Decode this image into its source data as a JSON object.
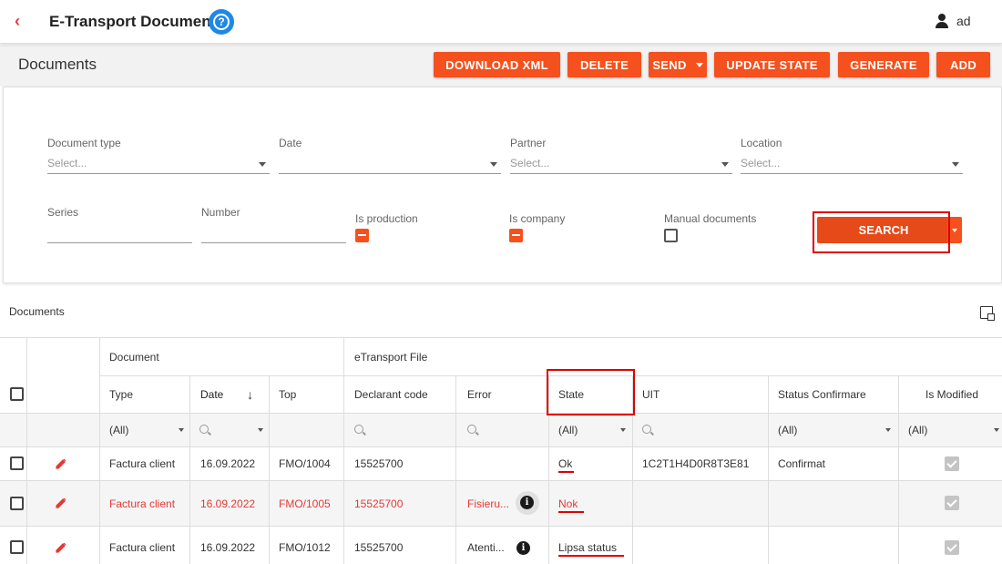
{
  "header": {
    "back_icon": "chevron-left-icon",
    "title": "E-Transport Documents",
    "help_icon": "?",
    "user": "ad"
  },
  "toolbar": {
    "title": "Documents",
    "buttons": {
      "download_xml": "DOWNLOAD XML",
      "delete": "DELETE",
      "send": "SEND",
      "update_state": "UPDATE STATE",
      "generate": "GENERATE",
      "add": "ADD"
    }
  },
  "filters": {
    "document_type": {
      "label": "Document type",
      "placeholder": "Select..."
    },
    "date": {
      "label": "Date",
      "placeholder": ""
    },
    "partner": {
      "label": "Partner",
      "placeholder": "Select..."
    },
    "location": {
      "label": "Location",
      "placeholder": "Select..."
    },
    "series": {
      "label": "Series",
      "value": ""
    },
    "number": {
      "label": "Number",
      "value": ""
    },
    "is_production": {
      "label": "Is production",
      "state": "indeterminate"
    },
    "is_company": {
      "label": "Is company",
      "state": "indeterminate"
    },
    "manual_documents": {
      "label": "Manual documents",
      "state": "unchecked"
    },
    "search_button": "SEARCH"
  },
  "grid": {
    "title": "Documents",
    "bands": {
      "document": "Document",
      "etransport": "eTransport File"
    },
    "columns": {
      "type": "Type",
      "date": "Date",
      "top": "Top",
      "declarant_code": "Declarant code",
      "error": "Error",
      "state": "State",
      "uit": "UIT",
      "status_confirmare": "Status Confirmare",
      "is_modified": "Is Modified"
    },
    "filter_row": {
      "type": "(All)",
      "state": "(All)",
      "status_confirmare": "(All)",
      "is_modified": "(All)"
    },
    "rows": [
      {
        "type": "Factura client",
        "date": "16.09.2022",
        "top": "FMO/1004",
        "declarant_code": "15525700",
        "error": "",
        "state": "Ok",
        "uit": "1C2T1H4D0R8T3E81",
        "status_confirmare": "Confirmat",
        "is_modified": true
      },
      {
        "type": "Factura client",
        "date": "16.09.2022",
        "top": "FMO/1005",
        "declarant_code": "15525700",
        "error": "Fisieru...",
        "state": "Nok",
        "uit": "",
        "status_confirmare": "",
        "is_modified": true
      },
      {
        "type": "Factura client",
        "date": "16.09.2022",
        "top": "FMO/1012",
        "declarant_code": "15525700",
        "error": "Atenti...",
        "state": "Lipsa status",
        "uit": "",
        "status_confirmare": "",
        "is_modified": true
      }
    ]
  },
  "accent_color": "#f4511e",
  "highlight_color": "#e00000"
}
